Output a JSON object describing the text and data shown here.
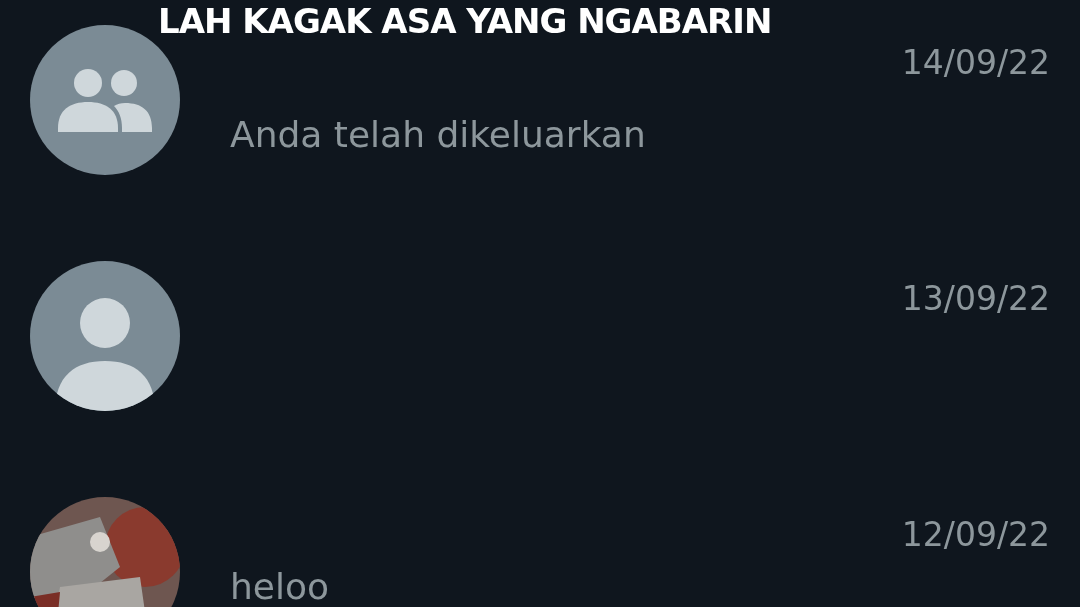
{
  "caption": "LAH KAGAK ASA YANG NGABARIN",
  "chats": [
    {
      "kind": "group",
      "date": "14/09/22",
      "message": "Anda telah dikeluarkan"
    },
    {
      "kind": "person",
      "date": "13/09/22"
    },
    {
      "kind": "picture",
      "date": "12/09/22",
      "message": "heloo"
    }
  ]
}
